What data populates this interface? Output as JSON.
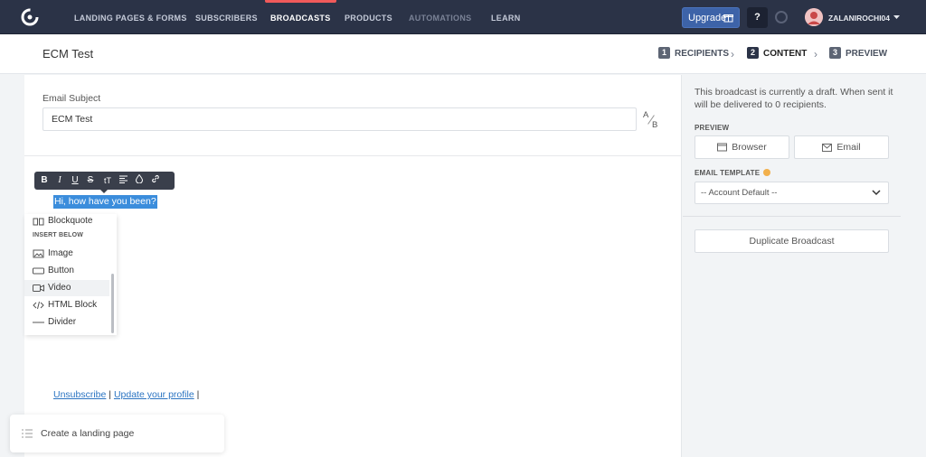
{
  "nav": {
    "items": [
      {
        "label": "LANDING PAGES & FORMS",
        "state": "normal"
      },
      {
        "label": "SUBSCRIBERS",
        "state": "normal"
      },
      {
        "label": "BROADCASTS",
        "state": "active"
      },
      {
        "label": "PRODUCTS",
        "state": "normal"
      },
      {
        "label": "AUTOMATIONS",
        "state": "dim"
      },
      {
        "label": "LEARN",
        "state": "normal"
      }
    ],
    "upgrade_label": "Upgrade",
    "help_label": "?",
    "user_name": "ZALANIROCHI04"
  },
  "header": {
    "title": "ECM Test",
    "steps": [
      {
        "num": "1",
        "label": "RECIPIENTS"
      },
      {
        "num": "2",
        "label": "CONTENT"
      },
      {
        "num": "3",
        "label": "PREVIEW"
      }
    ],
    "active_step": 2
  },
  "editor": {
    "subject_label": "Email Subject",
    "subject_value": "ECM Test",
    "ab_a": "A",
    "ab_b": "B",
    "format_tools": [
      "B",
      "I",
      "U",
      "S",
      "tT",
      "align",
      "color",
      "link"
    ],
    "selected_text": "Hi, how have you been?",
    "insert_menu": {
      "top_item": "Blockquote",
      "heading": "INSERT BELOW",
      "items": [
        "Image",
        "Button",
        "Video",
        "HTML Block",
        "Divider"
      ],
      "hovered": "Video"
    },
    "footer": {
      "unsubscribe": "Unsubscribe",
      "separator": "|",
      "update_profile": "Update your profile",
      "trailing": "|"
    }
  },
  "toast": {
    "label": "Create a landing page"
  },
  "sidebar": {
    "draft_text": "This broadcast is currently a draft. When sent it will be delivered to 0 recipients.",
    "preview_label": "PREVIEW",
    "browser_button": "Browser",
    "email_button": "Email",
    "template_label": "EMAIL TEMPLATE",
    "template_value": "-- Account Default --",
    "duplicate_button": "Duplicate Broadcast"
  },
  "colors": {
    "nav_bg": "#2b3347",
    "accent_red": "#f05a5a",
    "upgrade_blue": "#3d63a8",
    "selection_blue": "#3b8ddc",
    "link_blue": "#2b74c2",
    "status_orange": "#f2b04c"
  },
  "icons": {
    "logo": "convertkit-logo-icon",
    "gift": "gift-icon",
    "spinner": "loading-spinner-icon",
    "chevron": "chevron-down-icon"
  }
}
